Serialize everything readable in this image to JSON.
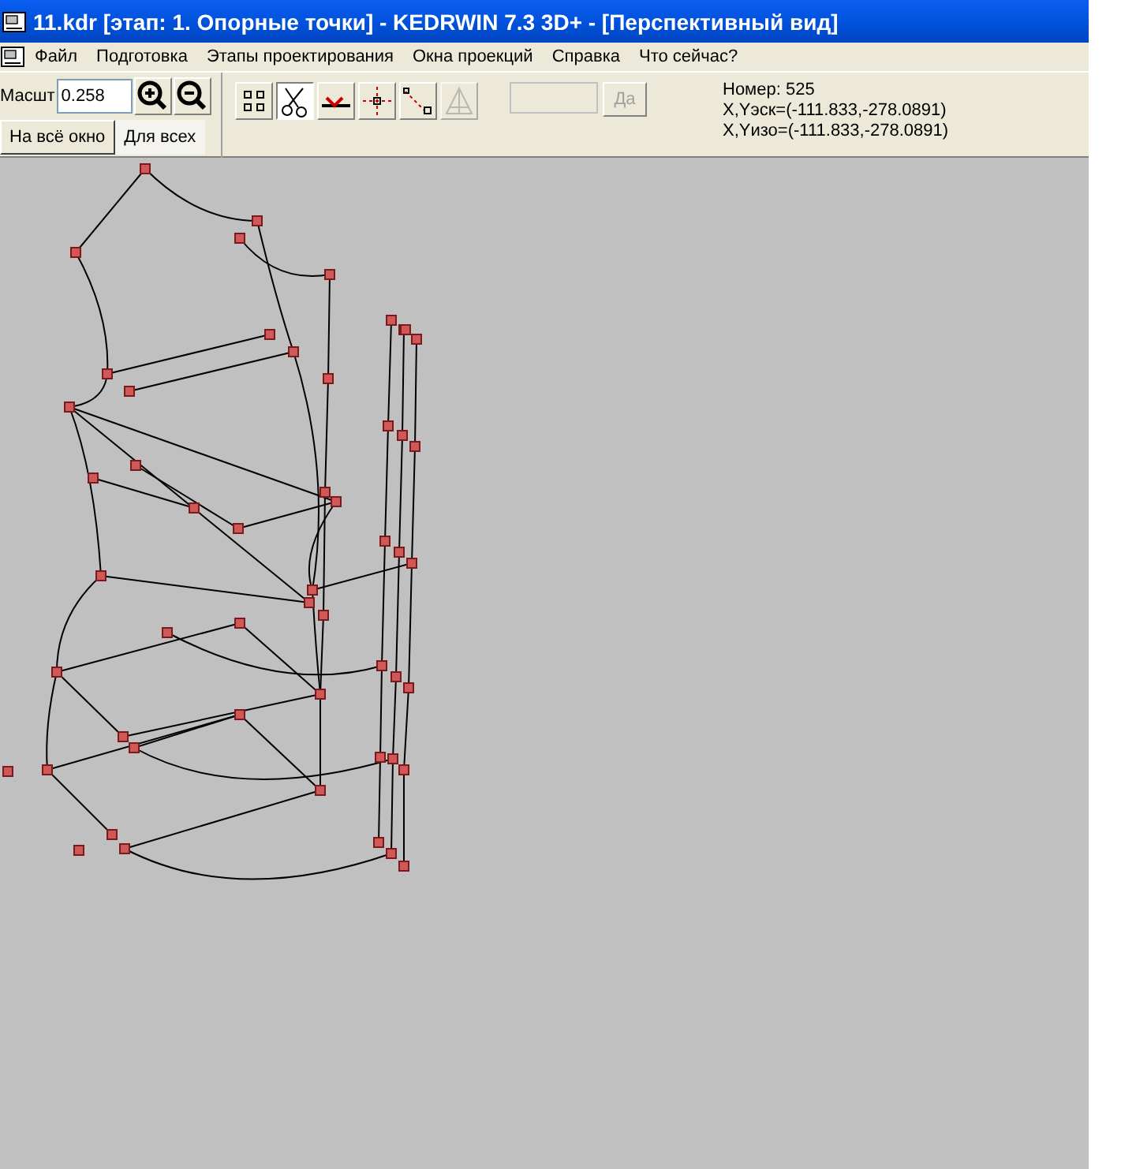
{
  "window": {
    "title": "11.kdr [этап: 1. Опорные точки] - KEDRWIN 7.3 3D+ - [Перспективный вид]"
  },
  "menu": [
    "Файл",
    "Подготовка",
    "Этапы проектирования",
    "Окна проекций",
    "Справка",
    "Что сейчас?"
  ],
  "toolbar": {
    "scale_label": "Масшт",
    "scale_value": "0.258",
    "view_tabs": [
      {
        "label": "На всё окно",
        "selected": false
      },
      {
        "label": "Для всех",
        "selected": true
      }
    ],
    "tools": [
      {
        "kind": "points",
        "pressed": false,
        "disabled": false
      },
      {
        "kind": "scissors",
        "pressed": true,
        "disabled": false
      },
      {
        "kind": "cut",
        "pressed": false,
        "disabled": false
      },
      {
        "kind": "cross",
        "pressed": false,
        "disabled": false
      },
      {
        "kind": "arrow",
        "pressed": false,
        "disabled": false
      },
      {
        "kind": "triangle",
        "pressed": false,
        "disabled": true
      }
    ],
    "confirm": {
      "label": "Да",
      "disabled": true
    }
  },
  "info": [
    "Номер: 525",
    "X,Yэск=(-111.833,-278.0891)",
    "X,Yизо=(-111.833,-278.0891)"
  ]
}
